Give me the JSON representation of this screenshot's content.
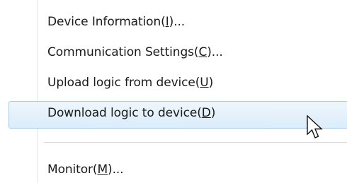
{
  "menu": {
    "items": [
      {
        "label_pre": "Device Information(",
        "mnemonic": "I",
        "label_post": ")...",
        "highlighted": false
      },
      {
        "label_pre": "Communication Settings(",
        "mnemonic": "C",
        "label_post": ")...",
        "highlighted": false
      },
      {
        "label_pre": "Upload logic from device(",
        "mnemonic": "U",
        "label_post": ")",
        "highlighted": false
      },
      {
        "label_pre": "Download logic to device(",
        "mnemonic": "D",
        "label_post": ")",
        "highlighted": true
      },
      {
        "label_pre": "Monitor(",
        "mnemonic": "M",
        "label_post": ")...",
        "highlighted": false
      }
    ]
  },
  "cursor": {
    "icon": "arrow-pointer-icon"
  },
  "colors": {
    "highlight_border": "#a9cbe8",
    "highlight_fill": "#dcecf9",
    "text": "#1a1a1a"
  }
}
